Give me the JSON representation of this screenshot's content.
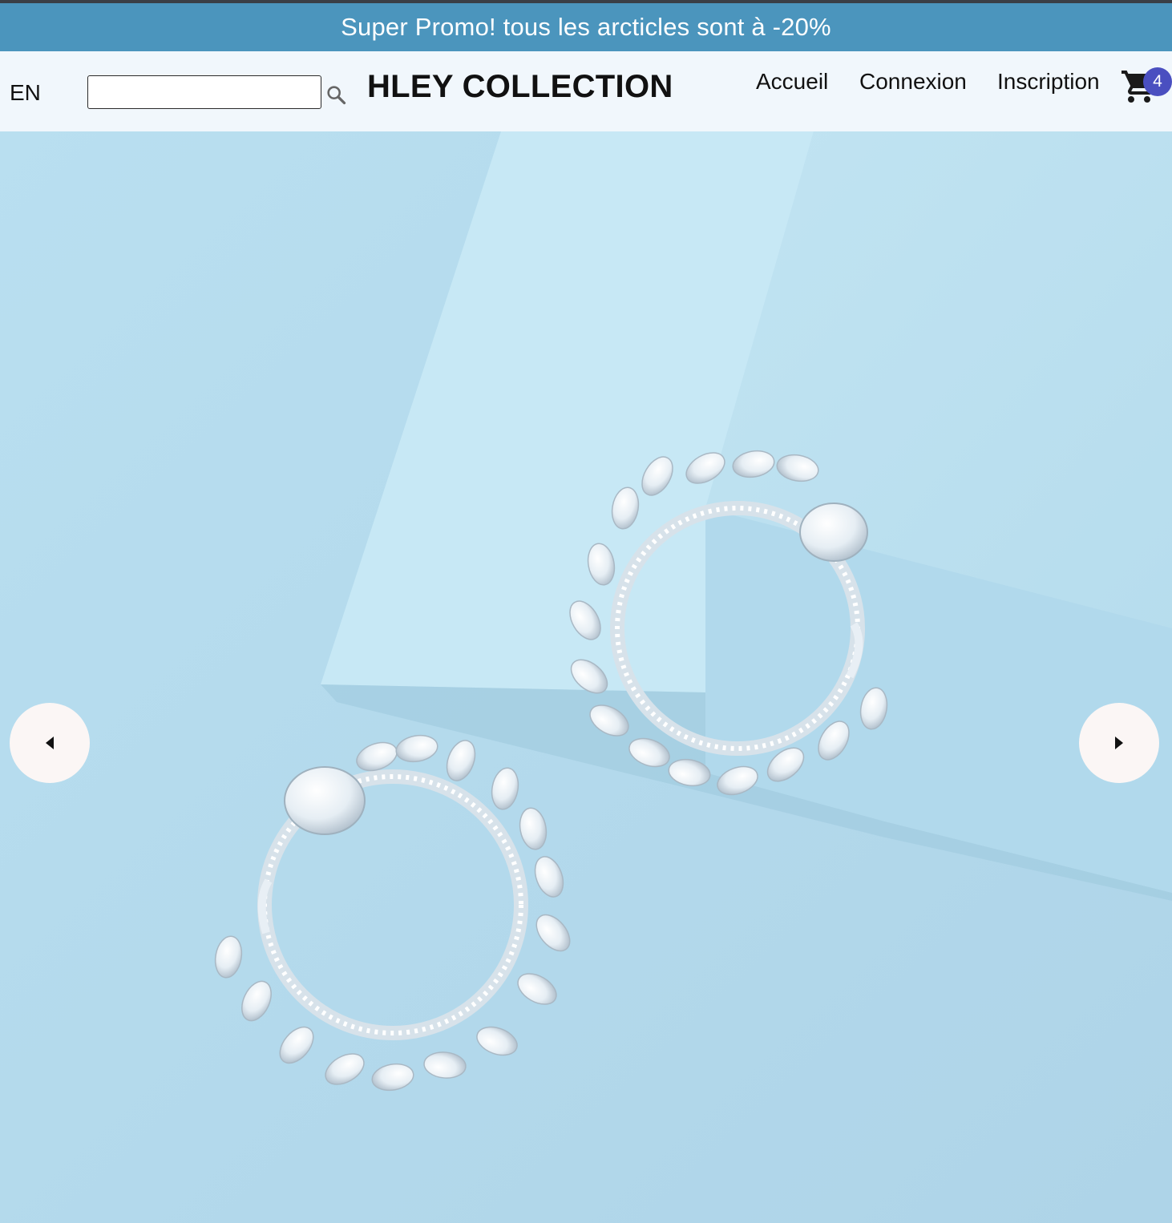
{
  "promo": {
    "text": "Super Promo! tous les arcticles sont à -20%",
    "background": "#4b95bd"
  },
  "header": {
    "language": "EN",
    "search": {
      "value": "",
      "placeholder": "",
      "icon": "search-icon"
    },
    "brand": "HLEY COLLECTION",
    "nav": {
      "home": "Accueil",
      "login": "Connexion",
      "signup": "Inscription"
    },
    "cart": {
      "icon": "cart-icon",
      "count": "4",
      "badge_color": "#4a4fc0"
    },
    "background": "#f1f7fc"
  },
  "carousel": {
    "slide_alt": "diamond hoop earrings on blue paper",
    "prev_icon": "triangle-left-icon",
    "next_icon": "triangle-right-icon",
    "background": "#b7dced"
  }
}
